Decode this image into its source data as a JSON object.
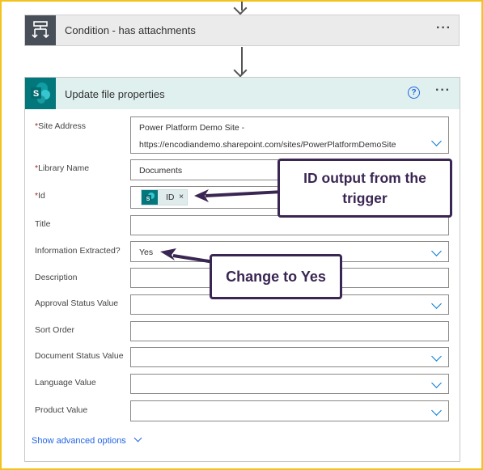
{
  "condition": {
    "title": "Condition - has attachments",
    "menu": "···"
  },
  "card": {
    "title": "Update file properties",
    "help": "?",
    "menu": "···",
    "fields": {
      "site_address": {
        "label": "Site Address",
        "required": "*",
        "value_line1": "Power Platform Demo Site -",
        "value_line2": "https://encodiandemo.sharepoint.com/sites/PowerPlatformDemoSite"
      },
      "library_name": {
        "label": "Library Name",
        "required": "*",
        "value": "Documents"
      },
      "id": {
        "label": "Id",
        "required": "*",
        "token": "ID",
        "token_remove": "×"
      },
      "title": {
        "label": "Title",
        "value": ""
      },
      "information_extracted": {
        "label": "Information Extracted?",
        "value": "Yes"
      },
      "description": {
        "label": "Description",
        "value": ""
      },
      "approval_status": {
        "label": "Approval Status Value",
        "value": ""
      },
      "sort_order": {
        "label": "Sort Order",
        "value": ""
      },
      "document_status": {
        "label": "Document Status Value",
        "value": ""
      },
      "language": {
        "label": "Language Value",
        "value": ""
      },
      "product": {
        "label": "Product Value",
        "value": ""
      }
    },
    "show_advanced": "Show advanced options"
  },
  "annotations": {
    "id_callout": "ID output from the trigger",
    "yes_callout": "Change to Yes"
  },
  "colors": {
    "border": "#f3c21c",
    "sharepoint": "#03787c",
    "card_header": "#dff0ef",
    "callout": "#3a2652",
    "link": "#2266e3"
  }
}
